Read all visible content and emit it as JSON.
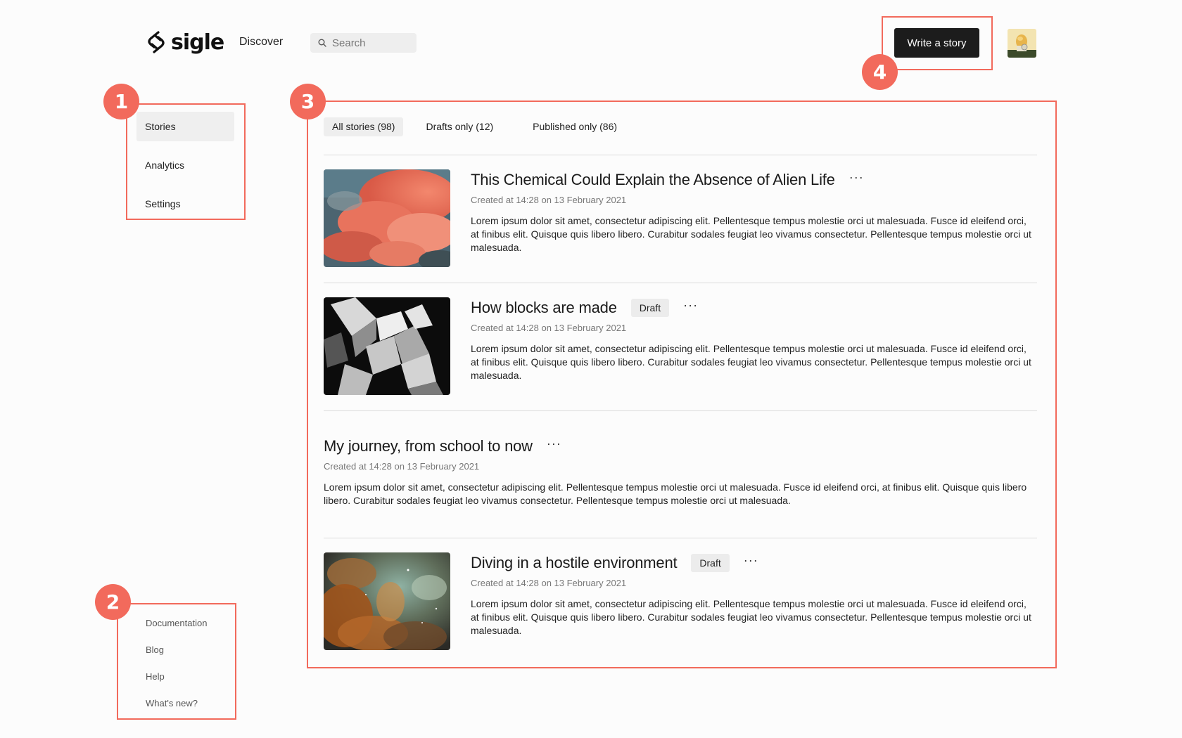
{
  "header": {
    "logo_text": "sigle",
    "nav_discover": "Discover",
    "search_placeholder": "Search",
    "write_button": "Write a story"
  },
  "sidebar": {
    "items": [
      {
        "label": "Stories",
        "active": true
      },
      {
        "label": "Analytics",
        "active": false
      },
      {
        "label": "Settings",
        "active": false
      }
    ],
    "footer_links": [
      "Documentation",
      "Blog",
      "Help",
      "What's new?"
    ]
  },
  "main": {
    "tabs": [
      {
        "label": "All stories (98)",
        "active": true
      },
      {
        "label": "Drafts only (12)",
        "active": false
      },
      {
        "label": "Published only (86)",
        "active": false
      }
    ],
    "stories": [
      {
        "title": "This Chemical Could Explain the Absence of Alien Life",
        "draft_badge": "",
        "date": "Created at 14:28 on 13 February 2021",
        "excerpt": "Lorem ipsum dolor sit amet, consectetur adipiscing elit. Pellentesque tempus molestie orci ut malesuada. Fusce id eleifend orci, at finibus elit. Quisque quis libero libero. Curabitur sodales feugiat leo vivamus consectetur. Pellentesque tempus molestie orci ut malesuada.",
        "image": "pink-clouds"
      },
      {
        "title": "How blocks are made",
        "draft_badge": "Draft",
        "date": "Created at 14:28 on 13 February 2021",
        "excerpt": "Lorem ipsum dolor sit amet, consectetur adipiscing elit. Pellentesque tempus molestie orci ut malesuada. Fusce id eleifend orci, at finibus elit. Quisque quis libero libero. Curabitur sodales feugiat leo vivamus consectetur. Pellentesque tempus molestie orci ut malesuada.",
        "image": "concrete-blocks"
      },
      {
        "title": "My journey, from school to now",
        "draft_badge": "",
        "date": "Created at 14:28 on 13 February 2021",
        "excerpt": "Lorem ipsum dolor sit amet, consectetur adipiscing elit. Pellentesque tempus molestie orci ut malesuada. Fusce id eleifend orci, at finibus elit. Quisque quis libero libero. Curabitur sodales feugiat leo vivamus consectetur. Pellentesque tempus molestie orci ut malesuada.",
        "image": ""
      },
      {
        "title": "Diving in a hostile environment",
        "draft_badge": "Draft",
        "date": "Created at 14:28 on 13 February 2021",
        "excerpt": "Lorem ipsum dolor sit amet, consectetur adipiscing elit. Pellentesque tempus molestie orci ut malesuada. Fusce id eleifend orci, at finibus elit. Quisque quis libero libero. Curabitur sodales feugiat leo vivamus consectetur. Pellentesque tempus molestie orci ut malesuada.",
        "image": "nebula"
      }
    ]
  },
  "annotations": [
    "1",
    "2",
    "3",
    "4"
  ],
  "icons": {
    "more": "more-dots-icon",
    "search": "search-icon",
    "logo": "sigle-logo-icon"
  },
  "colors": {
    "annotation": "#f26a5c",
    "primary_button": "#1c1c1c",
    "badge_bg": "#ececec"
  }
}
